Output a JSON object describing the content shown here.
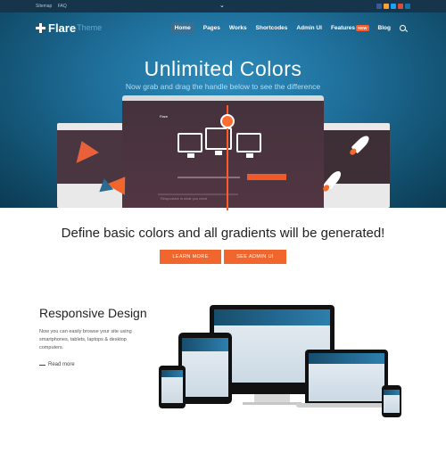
{
  "topbar": {
    "links": [
      "Sitemap",
      "FAQ"
    ],
    "social_colors": [
      "#3b5998",
      "#ffffff",
      "#1da1f2",
      "#dd4b39",
      "#0e76a8"
    ]
  },
  "nav": {
    "logo": "Flare",
    "logo_suffix": "Theme",
    "menu": [
      "Home",
      "Pages",
      "Works",
      "Shortcodes",
      "Admin UI",
      "Features",
      "Blog"
    ],
    "features_badge": "NEW"
  },
  "hero": {
    "title": "Unlimited Colors",
    "subtitle": "Now grab and drag the handle below to see the difference",
    "inner_logo": "Flare",
    "inner_text": "Responsive is what you need"
  },
  "cta": {
    "headline": "Define basic colors and all gradients will be generated!",
    "button1": "LEARN MORE",
    "button2": "SEE ADMIN UI"
  },
  "responsive": {
    "title": "Responsive Design",
    "description": "Now you can easily browse your site using smartphones, tablets, laptops & desktop computers.",
    "read_more": "Read more"
  },
  "colors": {
    "accent": "#f0662c",
    "hero_blue": "#1f6f9b",
    "topbar": "#16344a"
  }
}
